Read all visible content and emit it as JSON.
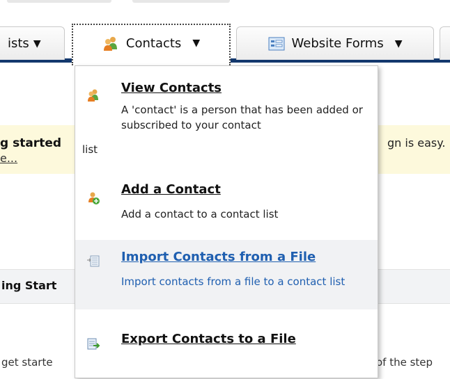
{
  "nav": {
    "tabs": [
      {
        "label": "ists"
      },
      {
        "label": "Contacts"
      },
      {
        "label": "Website Forms"
      }
    ]
  },
  "background": {
    "banner_left_bold": "g started",
    "banner_left_link": "e...",
    "banner_right": "gn is easy.",
    "section_heading": "ing Start",
    "bottom_left": "get starte",
    "bottom_right": "of the step"
  },
  "menu": {
    "items": [
      {
        "title": "View Contacts",
        "desc": "A 'contact' is a person that has been added or subscribed to your contact",
        "desc_wrap": "list",
        "icon": "contacts-icon"
      },
      {
        "title": "Add a Contact",
        "desc": "Add a contact to a contact list",
        "icon": "add-contact-icon"
      },
      {
        "title": "Import Contacts from a File",
        "desc": "Import contacts from a file to a contact list",
        "icon": "import-file-icon"
      },
      {
        "title": "Export Contacts to a File",
        "desc": "",
        "icon": "export-file-icon"
      }
    ]
  },
  "colors": {
    "nav_bar": "#13386d",
    "banner": "#fdf9dc",
    "hover_text": "#1f5fb0"
  }
}
